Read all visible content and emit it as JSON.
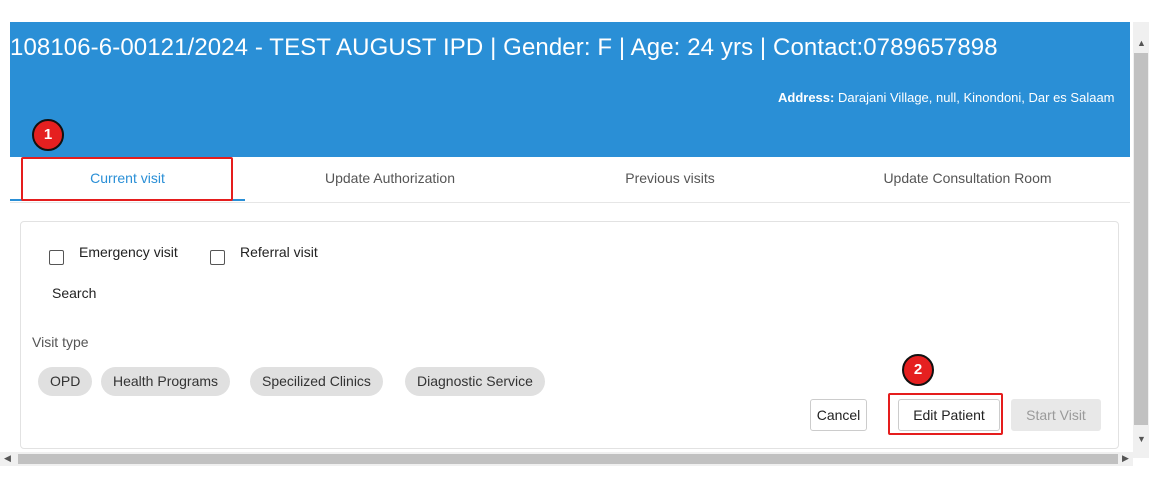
{
  "header": {
    "patient_title": "108106-6-00121/2024 - TEST AUGUST IPD | Gender: F | Age: 24 yrs | Contact:0789657898",
    "address_label": "Address:",
    "address_value": " Darajani Village, null, Kinondoni, Dar es Salaam",
    "bg_color": "#2a8fd6"
  },
  "tabs": [
    {
      "label": "Current visit",
      "active": true
    },
    {
      "label": "Update Authorization",
      "active": false
    },
    {
      "label": "Previous visits",
      "active": false
    },
    {
      "label": "Update Consultation Room",
      "active": false
    }
  ],
  "form": {
    "emergency_label": "Emergency visit",
    "referral_label": "Referral visit",
    "search_label": "Search",
    "visit_type_label": "Visit type",
    "chips": [
      "OPD",
      "Health Programs",
      "Specilized Clinics",
      "Diagnostic Service"
    ]
  },
  "actions": {
    "cancel": "Cancel",
    "edit_patient": "Edit Patient",
    "start_visit": "Start Visit"
  },
  "annotations": {
    "badge_1": "1",
    "badge_2": "2",
    "color": "#e51d1d"
  }
}
